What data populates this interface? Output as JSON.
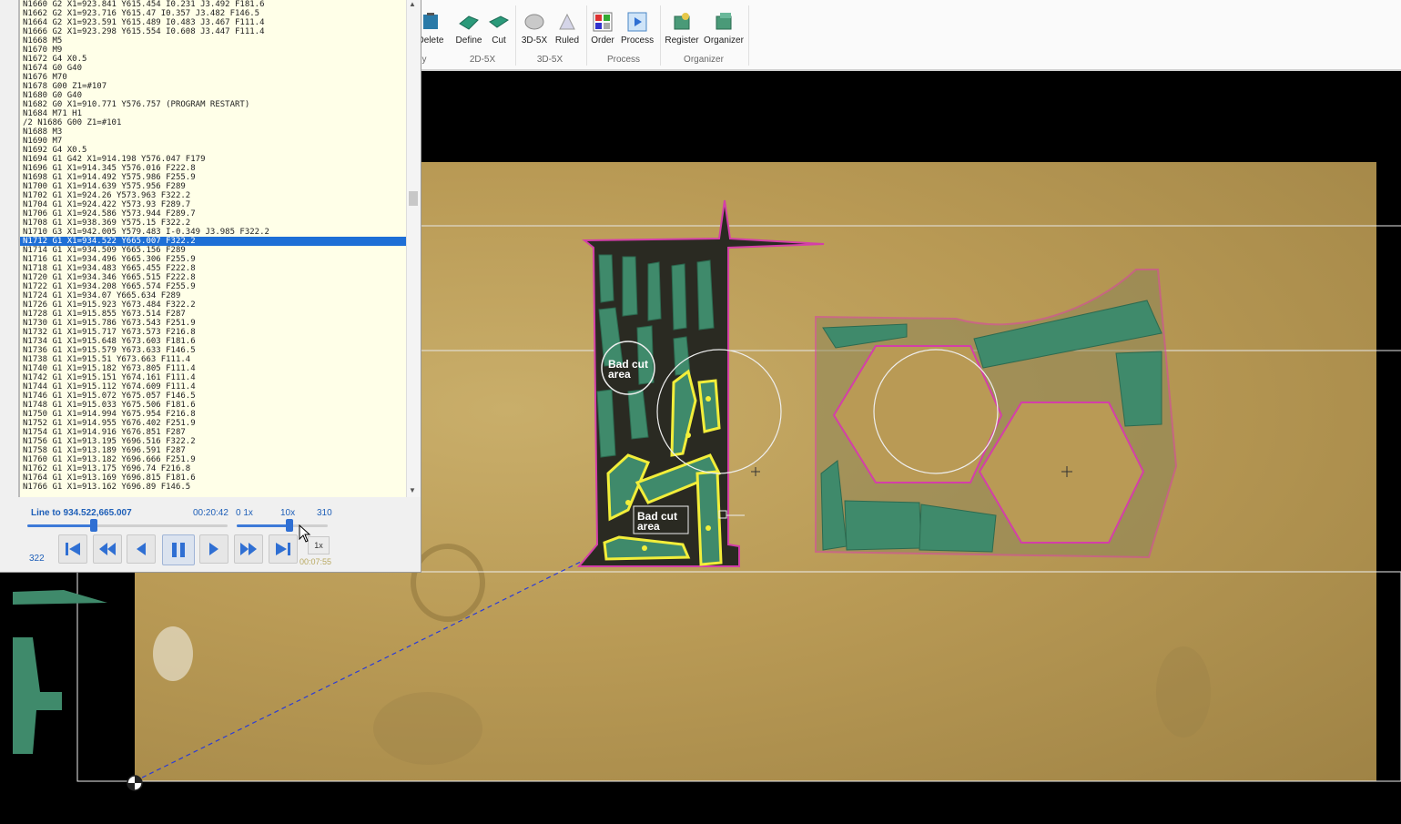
{
  "ribbon": {
    "buttons": [
      {
        "label": "Delete",
        "icon": "delete-icon"
      },
      {
        "label": "Define",
        "icon": "define-icon"
      },
      {
        "label": "Cut",
        "icon": "cut-icon"
      },
      {
        "label": "3D-5X",
        "icon": "3d5x-icon"
      },
      {
        "label": "Ruled",
        "icon": "ruled-icon"
      },
      {
        "label": "Order",
        "icon": "order-icon"
      },
      {
        "label": "Process",
        "icon": "process-icon"
      },
      {
        "label": "Register",
        "icon": "register-icon"
      },
      {
        "label": "Organizer",
        "icon": "organizer-icon"
      }
    ],
    "groups": [
      "y",
      "2D-5X",
      "3D-5X",
      "Process",
      "Organizer"
    ]
  },
  "gcode": {
    "lines": [
      "N1660 G2 X1=923.841 Y615.454 I0.231 J3.492 F181.6",
      "N1662 G2 X1=923.716 Y615.47 I0.357 J3.482 F146.5",
      "N1664 G2 X1=923.591 Y615.489 I0.483 J3.467 F111.4",
      "N1666 G2 X1=923.298 Y615.554 I0.608 J3.447 F111.4",
      "N1668 M5",
      "N1670 M9",
      "N1672 G4 X0.5",
      "N1674 G0 G40",
      "N1676 M70",
      "N1678 G00 Z1=#107",
      "N1680 G0 G40",
      "N1682 G0 X1=910.771 Y576.757 (PROGRAM RESTART)",
      "N1684 M71 H1",
      "/2 N1686 G00 Z1=#101",
      "N1688 M3",
      "N1690 M7",
      "N1692 G4 X0.5",
      "N1694 G1 G42 X1=914.198 Y576.047 F179",
      "N1696 G1 X1=914.345 Y576.016 F222.8",
      "N1698 G1 X1=914.492 Y575.986 F255.9",
      "N1700 G1 X1=914.639 Y575.956 F289",
      "N1702 G1 X1=924.26 Y573.963 F322.2",
      "N1704 G1 X1=924.422 Y573.93 F289.7",
      "N1706 G1 X1=924.586 Y573.944 F289.7",
      "N1708 G1 X1=938.369 Y575.15 F322.2",
      "N1710 G3 X1=942.005 Y579.483 I-0.349 J3.985 F322.2",
      "N1712 G1 X1=934.522 Y665.007 F322.2",
      "N1714 G1 X1=934.509 Y665.156 F289",
      "N1716 G1 X1=934.496 Y665.306 F255.9",
      "N1718 G1 X1=934.483 Y665.455 F222.8",
      "N1720 G1 X1=934.346 Y665.515 F222.8",
      "N1722 G1 X1=934.208 Y665.574 F255.9",
      "N1724 G1 X1=934.07 Y665.634 F289",
      "N1726 G1 X1=915.923 Y673.484 F322.2",
      "N1728 G1 X1=915.855 Y673.514 F287",
      "N1730 G1 X1=915.786 Y673.543 F251.9",
      "N1732 G1 X1=915.717 Y673.573 F216.8",
      "N1734 G1 X1=915.648 Y673.603 F181.6",
      "N1736 G1 X1=915.579 Y673.633 F146.5",
      "N1738 G1 X1=915.51 Y673.663 F111.4",
      "N1740 G1 X1=915.182 Y673.805 F111.4",
      "N1742 G1 X1=915.151 Y674.161 F111.4",
      "N1744 G1 X1=915.112 Y674.609 F111.4",
      "N1746 G1 X1=915.072 Y675.057 F146.5",
      "N1748 G1 X1=915.033 Y675.506 F181.6",
      "N1750 G1 X1=914.994 Y675.954 F216.8",
      "N1752 G1 X1=914.955 Y676.402 F251.9",
      "N1754 G1 X1=914.916 Y676.851 F287",
      "N1756 G1 X1=913.195 Y696.516 F322.2",
      "N1758 G1 X1=913.189 Y696.591 F287",
      "N1760 G1 X1=913.182 Y696.666 F251.9",
      "N1762 G1 X1=913.175 Y696.74 F216.8",
      "N1764 G1 X1=913.169 Y696.815 F181.6",
      "N1766 G1 X1=913.162 Y696.89 F146.5"
    ],
    "selected_index": 26
  },
  "playback": {
    "line_to": "Line to 934.522,665.007",
    "elapsed": "00:20:42",
    "speed_min": "0 1x",
    "speed_max": "10x",
    "total_lines": "310",
    "current_line": "322",
    "speed_button": "1x",
    "remaining": "00:07:55",
    "progress": 0.33,
    "speed_level": 0.58
  },
  "canvas": {
    "callouts": [
      {
        "line1": "Bad cut",
        "line2": "area"
      },
      {
        "line1": "Bad cut",
        "line2": "area"
      }
    ],
    "colors": {
      "part_fill": "#3f8a6b",
      "outline_magenta": "#d43fa8",
      "highlight_yellow": "#f2ee3a",
      "plate": "#b99a55",
      "dark_scrap": "#2a2a22"
    }
  }
}
